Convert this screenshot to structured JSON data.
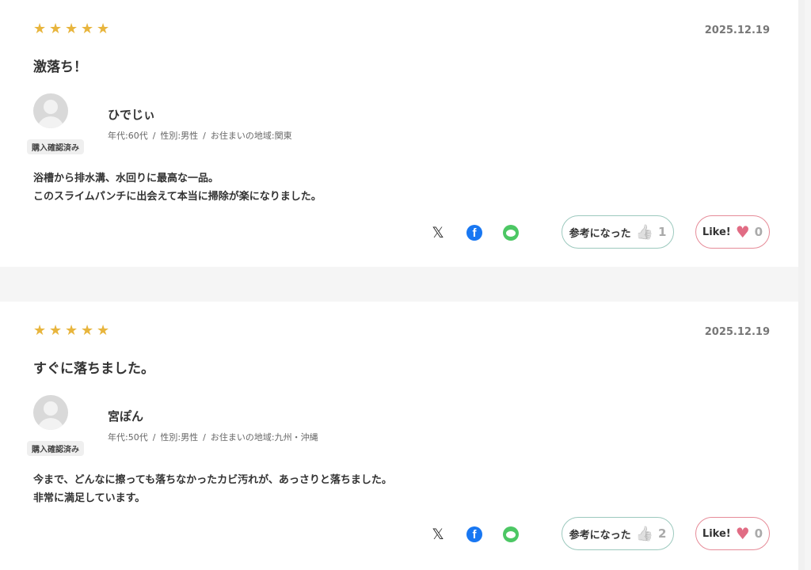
{
  "reviews": [
    {
      "date": "2025.12.19",
      "title": "激落ち！",
      "name": "ひでじぃ",
      "age": "年代:60代",
      "gender": "性別:男性",
      "region": "お住まいの地域:関東",
      "verified": "購入確認済み",
      "body_line1": "浴槽から排水溝、水回りに最高な一品。",
      "body_line2": "このスライムパンチに出会えて本当に掃除が楽になりました。",
      "helpful_label": "参考になった",
      "helpful_count": "1",
      "like_label": "Like!",
      "like_count": "0",
      "rating": 5
    },
    {
      "date": "2025.12.19",
      "title": "すぐに落ちました。",
      "name": "宮ぽん",
      "age": "年代:50代",
      "gender": "性別:男性",
      "region": "お住まいの地域:九州・沖縄",
      "verified": "購入確認済み",
      "body_line1": "今まで、どんなに擦っても落ちなかったカビ汚れが、あっさりと落ちました。",
      "body_line2": "非常に満足しています。",
      "helpful_label": "参考になった",
      "helpful_count": "2",
      "like_label": "Like!",
      "like_count": "0",
      "rating": 5
    }
  ],
  "colors": {
    "star": "#e8b53d",
    "helpful_border": "#9cc9be",
    "like_border": "#e68b98",
    "heart": "#e16c84",
    "facebook": "#1877f2",
    "line": "#4cc764"
  },
  "icons": {
    "separator": "/",
    "star": "★",
    "x_logo": "𝕏",
    "facebook_letter": "f",
    "thumb": "👍",
    "heart": "♥"
  }
}
